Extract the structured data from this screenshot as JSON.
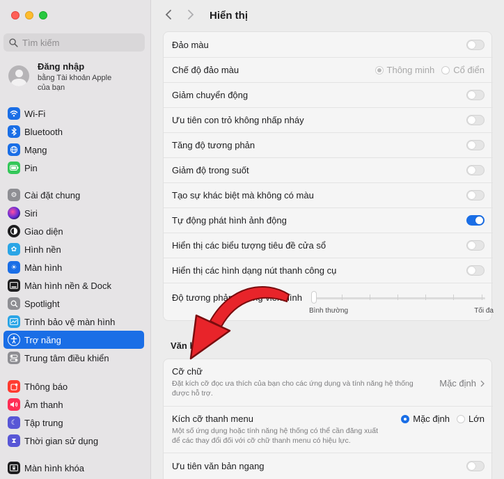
{
  "sidebar": {
    "search_placeholder": "Tìm kiếm",
    "account": {
      "title": "Đăng nhập",
      "subtitle_line1": "bằng Tài khoản Apple",
      "subtitle_line2": "của bạn"
    },
    "items": [
      {
        "label": "Wi-Fi",
        "icon": "wifi-icon",
        "color": "#1a6ee6"
      },
      {
        "label": "Bluetooth",
        "icon": "bluetooth-icon",
        "color": "#1a6ee6"
      },
      {
        "label": "Mạng",
        "icon": "globe-icon",
        "color": "#1a6ee6"
      },
      {
        "label": "Pin",
        "icon": "battery-icon",
        "color": "#34c759"
      },
      {
        "label": "Cài đặt chung",
        "icon": "gear-icon",
        "color": "#8e8e93"
      },
      {
        "label": "Siri",
        "icon": "siri-icon",
        "color": "#5e2bd6"
      },
      {
        "label": "Giao diện",
        "icon": "appearance-icon",
        "color": "#1d1d1f"
      },
      {
        "label": "Hình nền",
        "icon": "wallpaper-icon",
        "color": "#2aa5e6"
      },
      {
        "label": "Màn hình",
        "icon": "display-icon",
        "color": "#1a6ee6"
      },
      {
        "label": "Màn hình nền & Dock",
        "icon": "dock-icon",
        "color": "#1d1d1f"
      },
      {
        "label": "Spotlight",
        "icon": "spotlight-icon",
        "color": "#8e8e93"
      },
      {
        "label": "Trình bảo vệ màn hình",
        "icon": "screensaver-icon",
        "color": "#2aa5e6"
      },
      {
        "label": "Trợ năng",
        "icon": "accessibility-icon",
        "color": "#1a6ee6",
        "active": true
      },
      {
        "label": "Trung tâm điều khiển",
        "icon": "control-center-icon",
        "color": "#8e8e93"
      },
      {
        "label": "Thông báo",
        "icon": "notifications-icon",
        "color": "#ff3b30"
      },
      {
        "label": "Âm thanh",
        "icon": "sound-icon",
        "color": "#ff2d55"
      },
      {
        "label": "Tập trung",
        "icon": "moon-icon",
        "color": "#5856d6"
      },
      {
        "label": "Thời gian sử dụng",
        "icon": "hourglass-icon",
        "color": "#5856d6"
      },
      {
        "label": "Màn hình khóa",
        "icon": "lock-screen-icon",
        "color": "#1d1d1f"
      }
    ]
  },
  "header": {
    "title": "Hiển thị",
    "back_icon": "chevron-left-icon",
    "forward_icon": "chevron-right-icon"
  },
  "display_settings": [
    {
      "label": "Đảo màu",
      "type": "toggle",
      "on": false
    },
    {
      "label": "Chế độ đảo màu",
      "type": "radio",
      "options": [
        "Thông minh",
        "Cổ điển"
      ],
      "selected": 0,
      "disabled": true
    },
    {
      "label": "Giảm chuyển động",
      "type": "toggle",
      "on": false
    },
    {
      "label": "Ưu tiên con trỏ không nhấp nháy",
      "type": "toggle",
      "on": false
    },
    {
      "label": "Tăng độ tương phản",
      "type": "toggle",
      "on": false
    },
    {
      "label": "Giảm độ trong suốt",
      "type": "toggle",
      "on": false
    },
    {
      "label": "Tạo sự khác biệt mà không có màu",
      "type": "toggle",
      "on": false
    },
    {
      "label": "Tự động phát hình ảnh động",
      "type": "toggle",
      "on": true
    },
    {
      "label": "Hiển thị các biểu tượng tiêu đề cửa sổ",
      "type": "toggle",
      "on": false
    },
    {
      "label": "Hiển thị các hình dạng nút thanh công cụ",
      "type": "toggle",
      "on": false
    },
    {
      "label": "Độ tương phản đường viền hình",
      "type": "slider",
      "min_label": "Bình thường",
      "max_label": "Tối đa",
      "value": 0
    }
  ],
  "text_section": {
    "title": "Văn bản",
    "font_size": {
      "label": "Cỡ chữ",
      "description_line1": "Đặt kích cỡ đọc ưa thích của bạn cho các ứng dụng và tính năng hệ thống",
      "description_line2": "được hỗ trợ.",
      "value": "Mặc định"
    },
    "menu_bar_size": {
      "label": "Kích cỡ thanh menu",
      "description_line1": "Một số ứng dụng hoặc tính năng hệ thống có thể cần đăng xuất",
      "description_line2": "để các thay đổi đối với cỡ chữ thanh menu có hiệu lực.",
      "options": [
        "Mặc định",
        "Lớn"
      ],
      "selected": 0
    },
    "prefer_horizontal": {
      "label": "Ưu tiên văn bản ngang",
      "on": false
    }
  },
  "annotation": {
    "arrow_color": "#e8242a"
  }
}
